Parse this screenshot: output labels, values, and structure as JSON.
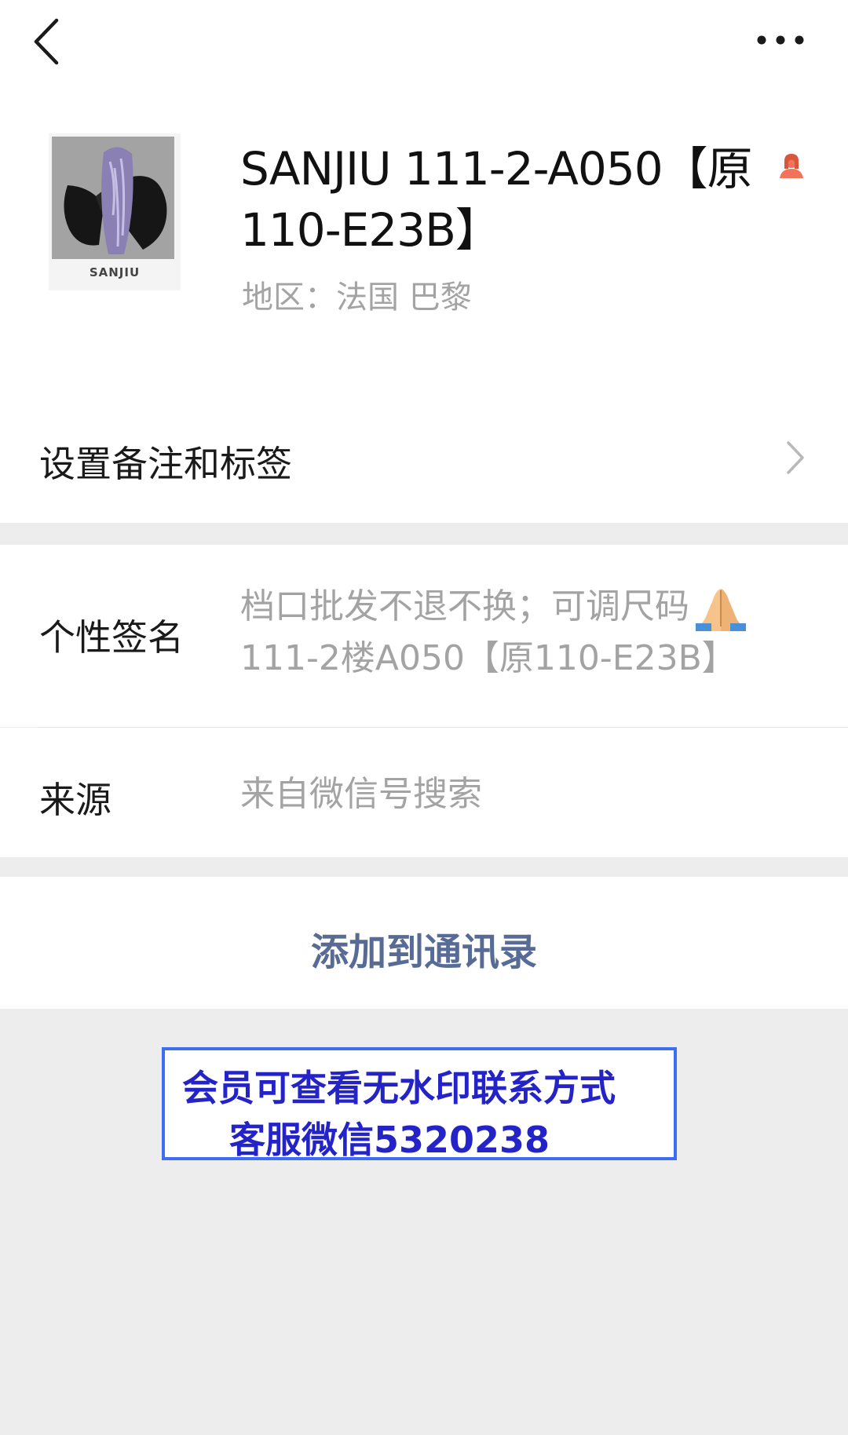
{
  "header": {
    "back_icon": "chevron-left-icon",
    "more_icon": "more-horizontal-icon"
  },
  "profile": {
    "avatar_brand_text": "SANJIU",
    "name": "SANJIU 111-2-A050【原110-E23B】",
    "gender_icon": "female-icon",
    "gender_icon_color": "#f0735a",
    "region": "地区：法国  巴黎"
  },
  "remark_row": {
    "label": "设置备注和标签",
    "chevron_icon": "chevron-right-icon"
  },
  "signature_row": {
    "label": "个性签名",
    "value_line1": "档口批发不退不换；可调尺码",
    "emoji": "folded-hands-icon",
    "value_line2": "111-2楼A050【原110-E23B】"
  },
  "source_row": {
    "label": "来源",
    "value": "来自微信号搜索"
  },
  "add_contact": {
    "label": "添加到通讯录",
    "color": "#576b95"
  },
  "watermark": {
    "line1": "会员可查看无水印联系方式",
    "line2": "客服微信5320238",
    "text_color": "#2323c8",
    "border_color": "#3d6df0"
  },
  "colors": {
    "page_background": "#ededed",
    "card_background": "#ffffff",
    "primary_text": "#1a1a1a",
    "secondary_text": "#a3a3a3"
  }
}
